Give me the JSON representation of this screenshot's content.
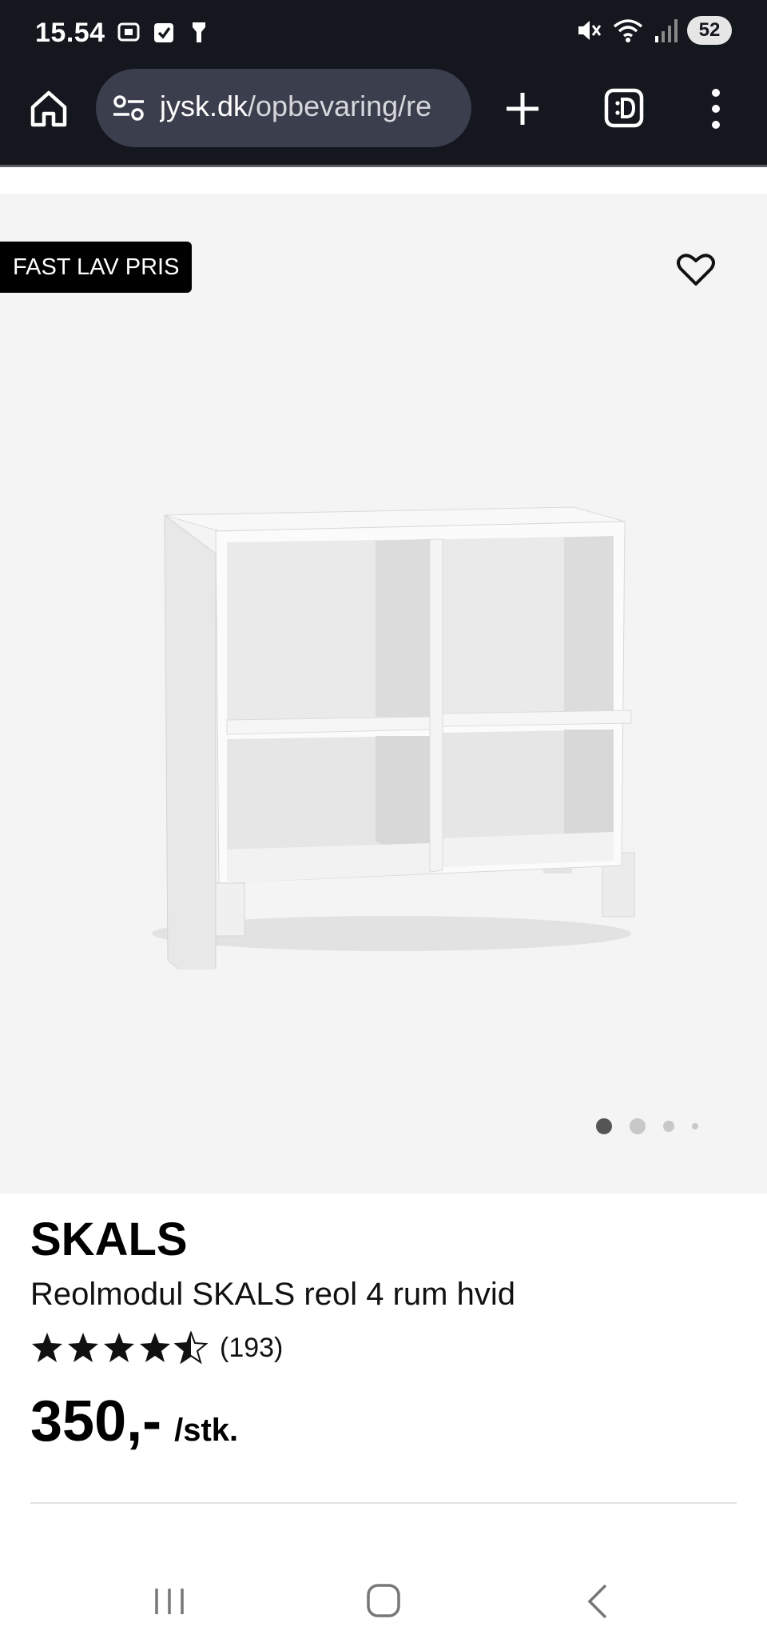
{
  "status_bar": {
    "time": "15.54",
    "battery": "52",
    "left_icons": [
      "screenshot-icon",
      "checkbox-icon",
      "torch-icon"
    ],
    "right_icons": [
      "mute-icon",
      "wifi-icon",
      "signal-icon"
    ]
  },
  "browser": {
    "url_domain": "jysk.dk",
    "url_path": "/opbevaring/re",
    "buttons": [
      "home-icon",
      "new-tab-icon",
      "tab-switcher-icon",
      "menu-icon"
    ]
  },
  "product": {
    "badge": "FAST LAV PRIS",
    "brand": "SKALS",
    "name": "Reolmodul SKALS reol 4 rum hvid",
    "rating": 4.5,
    "review_count": "(193)",
    "price": "350,-",
    "unit": "/stk.",
    "gallery_images": 4,
    "gallery_active": 1
  },
  "colors": {
    "system_bar": "#15171e",
    "url_field": "#3b3e4d",
    "badge_bg": "#000000",
    "gallery_bg": "#f4f4f4"
  }
}
